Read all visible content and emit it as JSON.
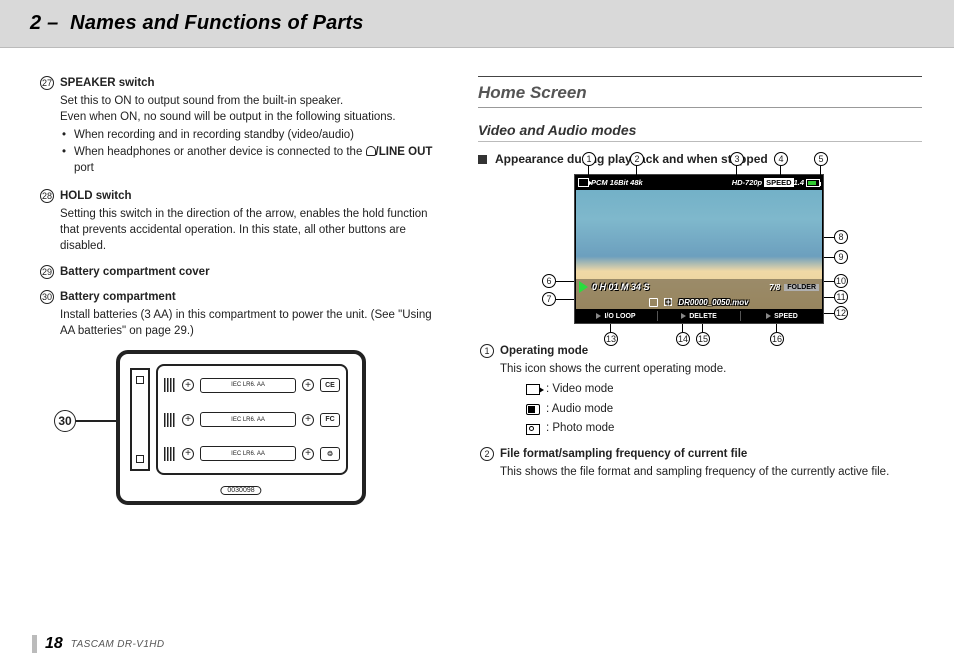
{
  "header": {
    "section_num": "2 –",
    "title": "Names and Functions of Parts"
  },
  "left": {
    "items": [
      {
        "num": "27",
        "title": "SPEAKER switch",
        "desc": "Set this to ON to output sound from the built-in speaker.\nEven when ON, no sound will be output in the following situations.",
        "bullets": [
          "When recording and in recording standby (video/audio)",
          "When headphones or another device is connected to the "
        ],
        "tail_after_icon": "/LINE OUT",
        "tail_end": " port"
      },
      {
        "num": "28",
        "title": "HOLD switch",
        "desc": "Setting this switch in the direction of the arrow, enables the hold function that prevents accidental operation. In this state, all other buttons are disabled."
      },
      {
        "num": "29",
        "title": "Battery compartment cover"
      },
      {
        "num": "30",
        "title": "Battery compartment",
        "desc": "Install batteries (3 AA) in this compartment to power the unit. (See \"Using AA batteries\" on page 29.)"
      }
    ],
    "diagram": {
      "callout": "30",
      "row_label": "IEC LR6. AA",
      "ce_logo": "CE",
      "fc_logo": "FC",
      "serial": "0030098"
    }
  },
  "right": {
    "h2": "Home Screen",
    "h3": "Video and Audio modes",
    "h4": "Appearance during playback and when stopped",
    "screen": {
      "pcm": "PCM 16Bit 48k",
      "hd": "HD-720p",
      "speed_badge_label": "SPEED",
      "speed_badge_val": "1.4",
      "time": "0 H 01 M 34 S",
      "idx": "7/8",
      "folder": "FOLDER",
      "file": "DR0000_0050.mov",
      "f1": "I/O LOOP",
      "f2": "DELETE",
      "f3": "SPEED"
    },
    "callouts": [
      "1",
      "2",
      "3",
      "4",
      "5",
      "6",
      "7",
      "8",
      "9",
      "10",
      "11",
      "12",
      "13",
      "14",
      "15",
      "16"
    ],
    "r_items": [
      {
        "num": "1",
        "title": "Operating mode",
        "desc": "This icon shows the current operating mode.",
        "modes": [
          {
            "icon": "v",
            "label": ":  Video mode"
          },
          {
            "icon": "a",
            "label": ":  Audio mode"
          },
          {
            "icon": "p",
            "label": ":  Photo mode"
          }
        ]
      },
      {
        "num": "2",
        "title": "File format/sampling frequency of current file",
        "desc": "This shows the file format and sampling frequency of the currently active file."
      }
    ]
  },
  "footer": {
    "page": "18",
    "model": "TASCAM  DR-V1HD"
  }
}
